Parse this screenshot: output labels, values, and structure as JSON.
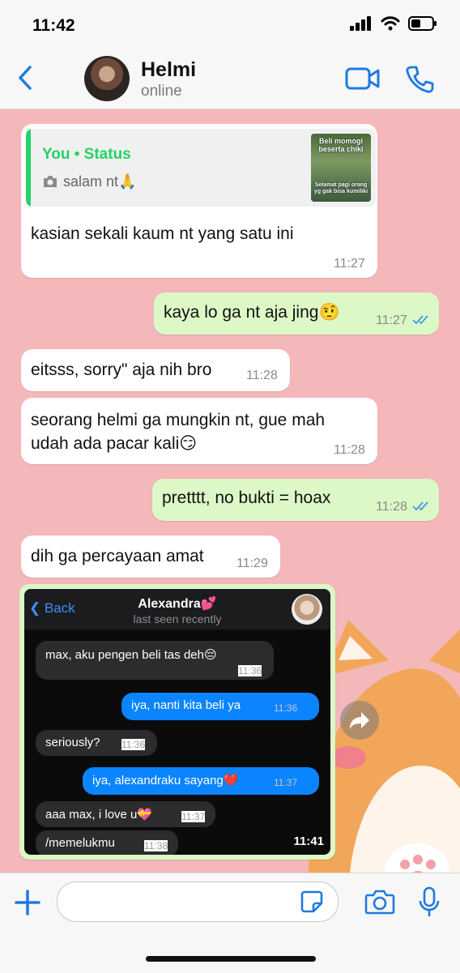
{
  "status_bar": {
    "time": "11:42"
  },
  "header": {
    "name": "Helmi",
    "status": "online"
  },
  "messages": [
    {
      "quote_title": "You • Status",
      "quote_text": "salam nt🙏",
      "thumb_caption_top": "Beli momogi beserta chiki",
      "thumb_caption_bottom": "Selamat pagi orang yg gak bisa kumiliki",
      "text": "kasian sekali kaum nt yang satu ini",
      "time": "11:27"
    },
    {
      "text": "kaya lo ga nt aja jing🤨",
      "time": "11:27"
    },
    {
      "text": "eitsss, sorry\" aja nih bro",
      "time": "11:28"
    },
    {
      "line1": "seorang helmi ga mungkin nt, gue mah",
      "line2": "udah ada pacar kali😏",
      "time": "11:28"
    },
    {
      "text": "pretttt, no bukti = hoax",
      "time": "11:28"
    },
    {
      "text": "dih ga percayaan amat",
      "time": "11:29"
    }
  ],
  "screenshot": {
    "back_label": "Back",
    "name": "Alexandra💕",
    "last_seen": "last seen recently",
    "clock": "11:41",
    "messages": [
      {
        "text": "max, aku pengen beli tas deh😔",
        "time": "11:36"
      },
      {
        "text": "iya, nanti kita beli ya",
        "time": "11:36"
      },
      {
        "text": "seriously?",
        "time": "11:36"
      },
      {
        "text": "iya, alexandraku sayang❤️",
        "time": "11:37"
      },
      {
        "text": "aaa max, i love u💝",
        "time": "11:37"
      },
      {
        "text": "/memelukmu",
        "time": "11:38"
      }
    ]
  },
  "colors": {
    "accent": "#1f7ae0",
    "outgoing": "#dcf8c6",
    "incoming": "#ffffff",
    "status_green": "#25d366",
    "wallpaper": "#f4b8bb"
  }
}
